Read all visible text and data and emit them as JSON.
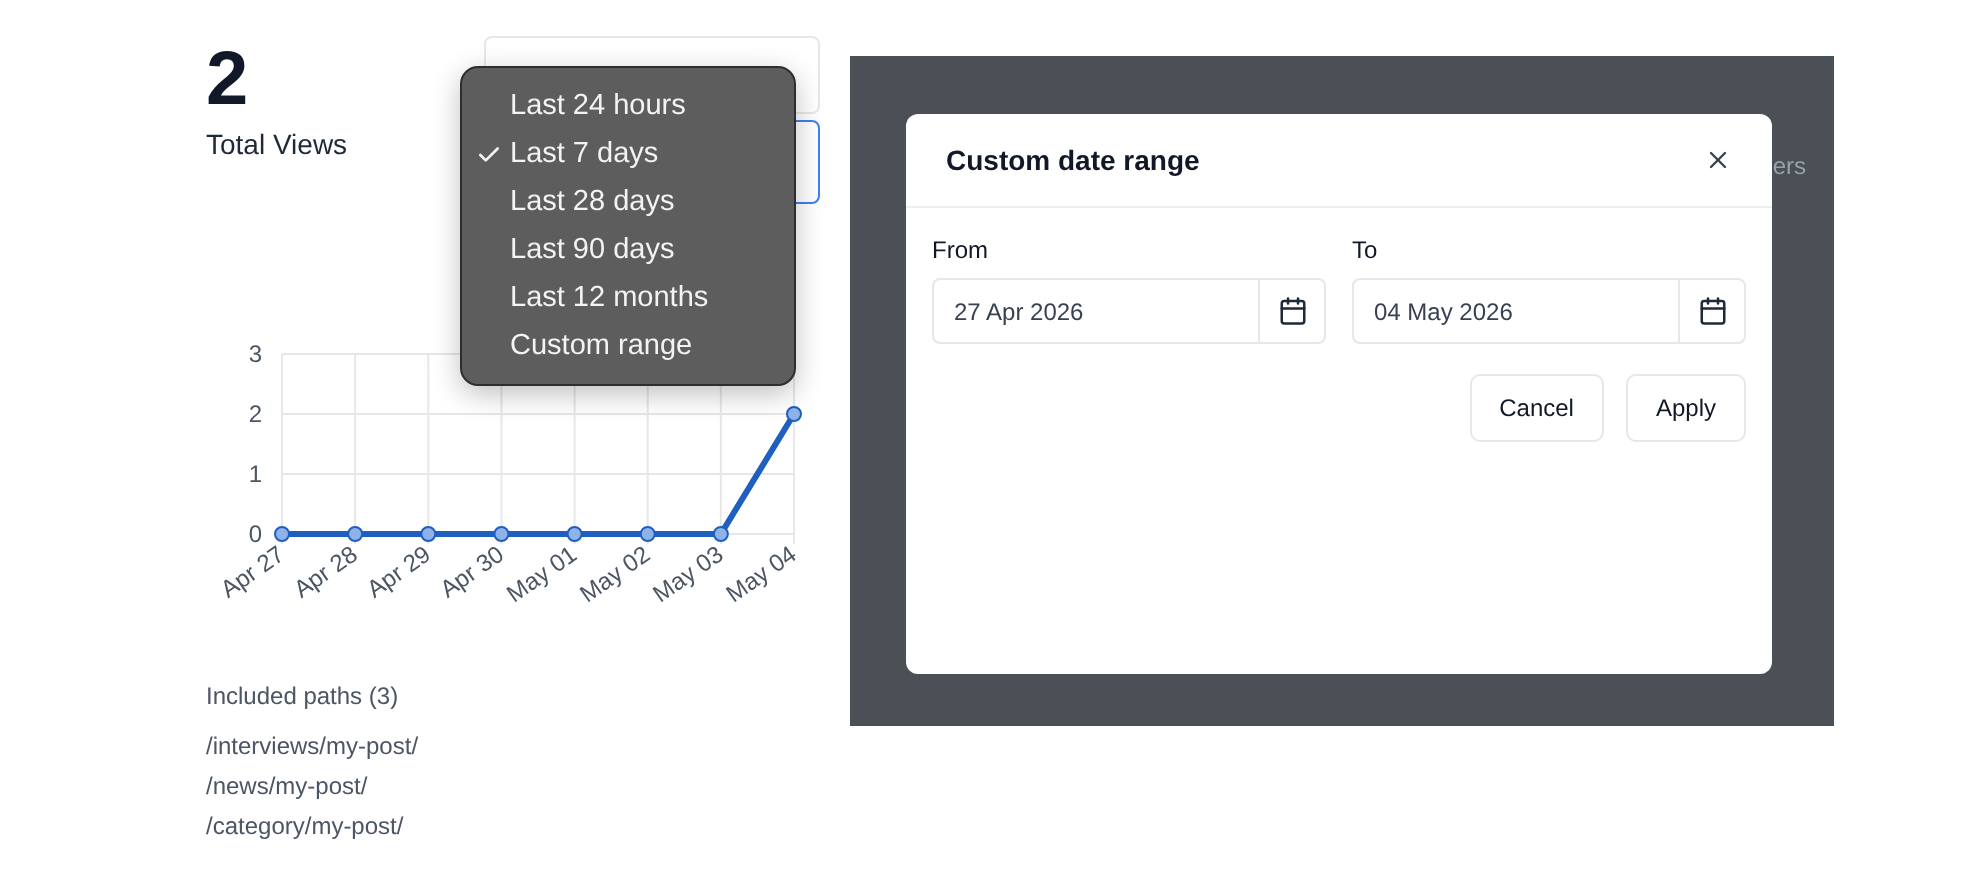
{
  "stat": {
    "value": "2",
    "label": "Total Views"
  },
  "range_menu": {
    "items": [
      {
        "label": "Last 24 hours",
        "selected": false
      },
      {
        "label": "Last 7 days",
        "selected": true
      },
      {
        "label": "Last 28 days",
        "selected": false
      },
      {
        "label": "Last 90 days",
        "selected": false
      },
      {
        "label": "Last 12 months",
        "selected": false
      },
      {
        "label": "Custom range",
        "selected": false
      }
    ]
  },
  "chart": {
    "chart_data": {
      "type": "line",
      "categories": [
        "Apr 27",
        "Apr 28",
        "Apr 29",
        "Apr 30",
        "May 01",
        "May 02",
        "May 03",
        "May 04"
      ],
      "series": [
        {
          "color": "#1e5fbf",
          "marker": true,
          "values": [
            0,
            0,
            0,
            0,
            0,
            0,
            0,
            2
          ]
        }
      ],
      "ylim": [
        0,
        3
      ],
      "yticks": [
        0,
        1,
        2,
        3
      ],
      "grid": true
    }
  },
  "included_paths": {
    "title": "Included paths (3)",
    "paths": [
      "/interviews/my-post/",
      "/news/my-post/",
      "/category/my-post/"
    ]
  },
  "background_text": "ers",
  "modal": {
    "title": "Custom date range",
    "fields": [
      {
        "label": "From",
        "value": "27 Apr 2026"
      },
      {
        "label": "To",
        "value": "04 May 2026"
      }
    ],
    "buttons": [
      "Cancel",
      "Apply"
    ]
  }
}
